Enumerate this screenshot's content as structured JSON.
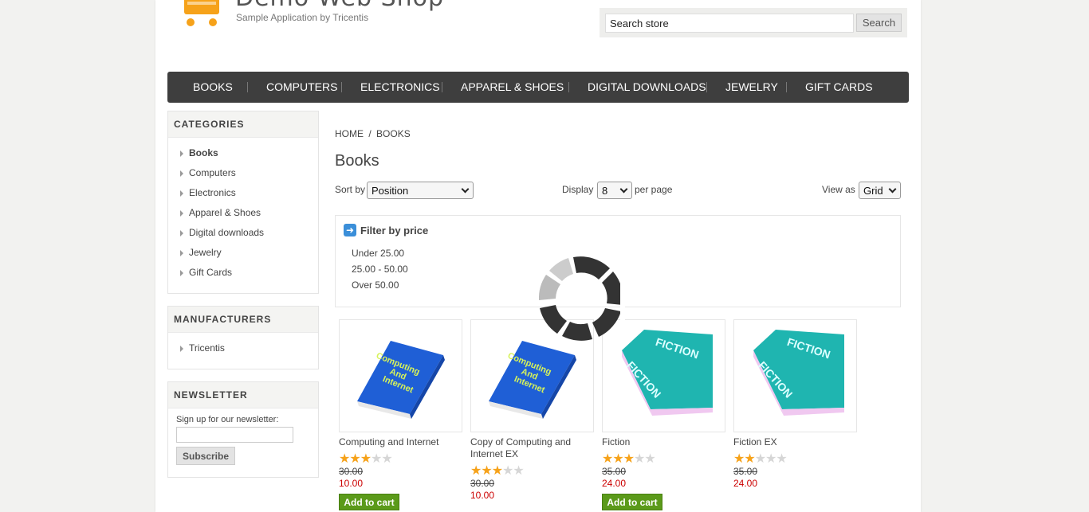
{
  "header": {
    "logo_title": "Demo Web Shop",
    "logo_subtitle": "Sample Application by Tricentis",
    "search": {
      "value": "Search store",
      "button": "Search"
    }
  },
  "top_menu": [
    "BOOKS",
    "COMPUTERS",
    "ELECTRONICS",
    "APPAREL & SHOES",
    "DIGITAL DOWNLOADS",
    "JEWELRY",
    "GIFT CARDS"
  ],
  "categories": {
    "title": "CATEGORIES",
    "items": [
      "Books",
      "Computers",
      "Electronics",
      "Apparel & Shoes",
      "Digital downloads",
      "Jewelry",
      "Gift Cards"
    ],
    "active": "Books"
  },
  "manufacturers": {
    "title": "MANUFACTURERS",
    "items": [
      "Tricentis"
    ]
  },
  "newsletter": {
    "title": "NEWSLETTER",
    "label": "Sign up for our newsletter:",
    "button": "Subscribe"
  },
  "breadcrumb": {
    "home": "HOME",
    "sep": "/",
    "current": "BOOKS"
  },
  "page_title": "Books",
  "controls": {
    "sort_label": "Sort by",
    "sort_value": "Position",
    "display_label": "Display",
    "display_value": "8",
    "per_page": "per page",
    "view_label": "View as",
    "view_value": "Grid"
  },
  "filter": {
    "title": "Filter by price",
    "ranges": [
      "Under 25.00",
      "25.00 - 50.00",
      "Over 50.00"
    ]
  },
  "products": [
    {
      "title": "Computing and Internet",
      "rating": 2.5,
      "old_price": "30.00",
      "price": "10.00",
      "button": "Add to cart",
      "cover": "Computing And Internet"
    },
    {
      "title": "Copy of Computing and Internet EX",
      "rating": 2.5,
      "old_price": "30.00",
      "price": "10.00",
      "button": "",
      "cover": "Computing And Internet"
    },
    {
      "title": "Fiction",
      "rating": 2.5,
      "old_price": "35.00",
      "price": "24.00",
      "button": "Add to cart",
      "cover": "FICTION"
    },
    {
      "title": "Fiction EX",
      "rating": 2,
      "old_price": "35.00",
      "price": "24.00",
      "button": "",
      "cover": "FICTION"
    }
  ],
  "colors": {
    "menu_bg": "#3e3e3e",
    "price_red": "#cc0000",
    "star_orange": "#f6a21a",
    "button_green": "#5b9a1a",
    "blue_book": "#1f5fd6",
    "teal_book": "#1fb5b0"
  },
  "icons": [
    "cart-icon",
    "arrow-right-icon",
    "loading-spinner-icon",
    "star-icon"
  ]
}
